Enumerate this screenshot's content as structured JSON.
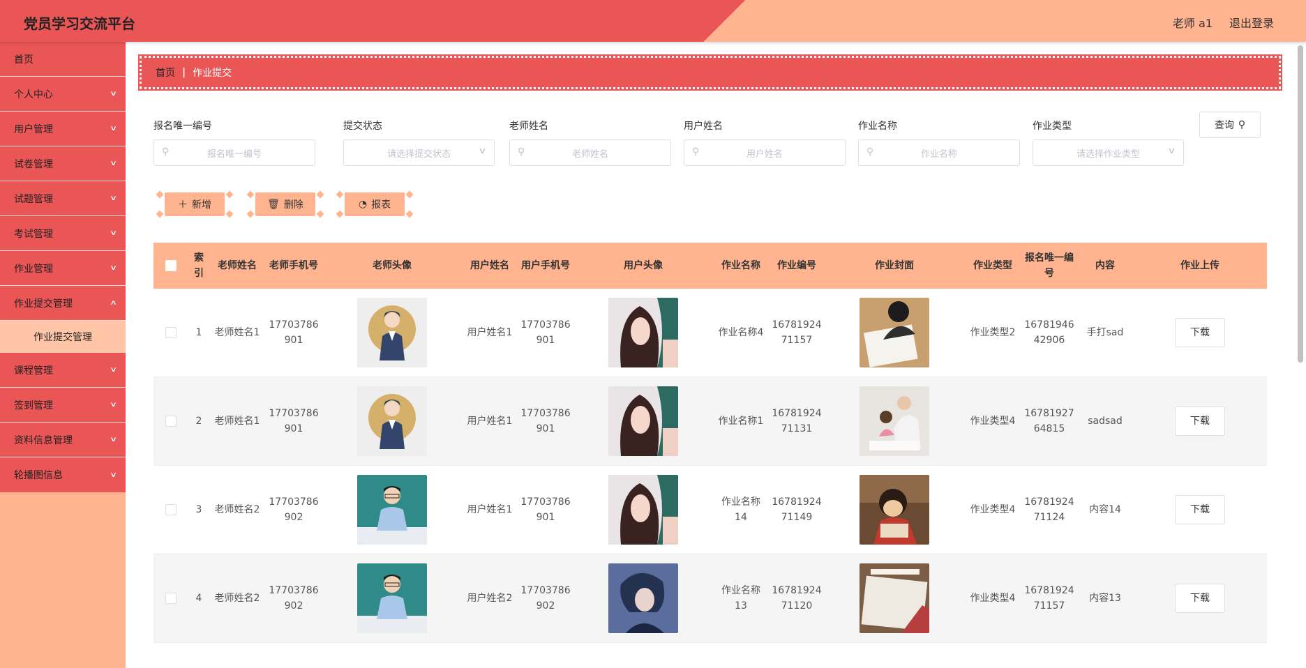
{
  "header": {
    "title": "党员学习交流平台",
    "user": "老师 a1",
    "logout": "退出登录"
  },
  "sidebar": {
    "items": [
      {
        "label": "首页",
        "chevron": false
      },
      {
        "label": "个人中心",
        "chevron": true
      },
      {
        "label": "用户管理",
        "chevron": true
      },
      {
        "label": "试卷管理",
        "chevron": true
      },
      {
        "label": "试题管理",
        "chevron": true
      },
      {
        "label": "考试管理",
        "chevron": true
      },
      {
        "label": "作业管理",
        "chevron": true
      },
      {
        "label": "作业提交管理",
        "chevron": true,
        "expanded": true
      },
      {
        "label": "课程管理",
        "chevron": true
      },
      {
        "label": "签到管理",
        "chevron": true
      },
      {
        "label": "资料信息管理",
        "chevron": true
      },
      {
        "label": "轮播图信息",
        "chevron": true
      }
    ],
    "submenu": {
      "label": "作业提交管理"
    }
  },
  "breadcrumb": {
    "home": "首页",
    "current": "作业提交"
  },
  "filters": {
    "signup_id": {
      "label": "报名唯一编号",
      "placeholder": "报名唯一编号"
    },
    "status": {
      "label": "提交状态",
      "placeholder": "请选择提交状态"
    },
    "teacher": {
      "label": "老师姓名",
      "placeholder": "老师姓名"
    },
    "user": {
      "label": "用户姓名",
      "placeholder": "用户姓名"
    },
    "homework": {
      "label": "作业名称",
      "placeholder": "作业名称"
    },
    "type": {
      "label": "作业类型",
      "placeholder": "请选择作业类型"
    },
    "query": "查询"
  },
  "actions": {
    "add": "新增",
    "delete": "删除",
    "report": "报表"
  },
  "table": {
    "headers": {
      "index": "索引",
      "teacher_name": "老师姓名",
      "teacher_phone": "老师手机号",
      "teacher_avatar": "老师头像",
      "user_name": "用户姓名",
      "user_phone": "用户手机号",
      "user_avatar": "用户头像",
      "hw_name": "作业名称",
      "hw_no": "作业编号",
      "hw_cover": "作业封面",
      "hw_type": "作业类型",
      "signup_no": "报名唯一编号",
      "content": "内容",
      "upload": "作业上传"
    },
    "download_label": "下载",
    "rows": [
      {
        "index": "1",
        "teacher_name": "老师姓名1",
        "teacher_phone": "17703786901",
        "user_name": "用户姓名1",
        "user_phone": "17703786901",
        "hw_name": "作业名称4",
        "hw_no": "1678192471157",
        "hw_type": "作业类型2",
        "signup_no": "1678194642906",
        "content": "手打sad"
      },
      {
        "index": "2",
        "teacher_name": "老师姓名1",
        "teacher_phone": "17703786901",
        "user_name": "用户姓名1",
        "user_phone": "17703786901",
        "hw_name": "作业名称1",
        "hw_no": "1678192471131",
        "hw_type": "作业类型4",
        "signup_no": "1678192764815",
        "content": "sadsad"
      },
      {
        "index": "3",
        "teacher_name": "老师姓名2",
        "teacher_phone": "17703786902",
        "user_name": "用户姓名1",
        "user_phone": "17703786901",
        "hw_name": "作业名称14",
        "hw_no": "1678192471149",
        "hw_type": "作业类型4",
        "signup_no": "1678192471124",
        "content": "内容14"
      },
      {
        "index": "4",
        "teacher_name": "老师姓名2",
        "teacher_phone": "17703786902",
        "user_name": "用户姓名2",
        "user_phone": "17703786902",
        "hw_name": "作业名称13",
        "hw_no": "1678192471120",
        "hw_type": "作业类型4",
        "signup_no": "1678192471157",
        "content": "内容13"
      }
    ]
  },
  "colors": {
    "primary": "#ea5555",
    "accent": "#ffb38f"
  }
}
